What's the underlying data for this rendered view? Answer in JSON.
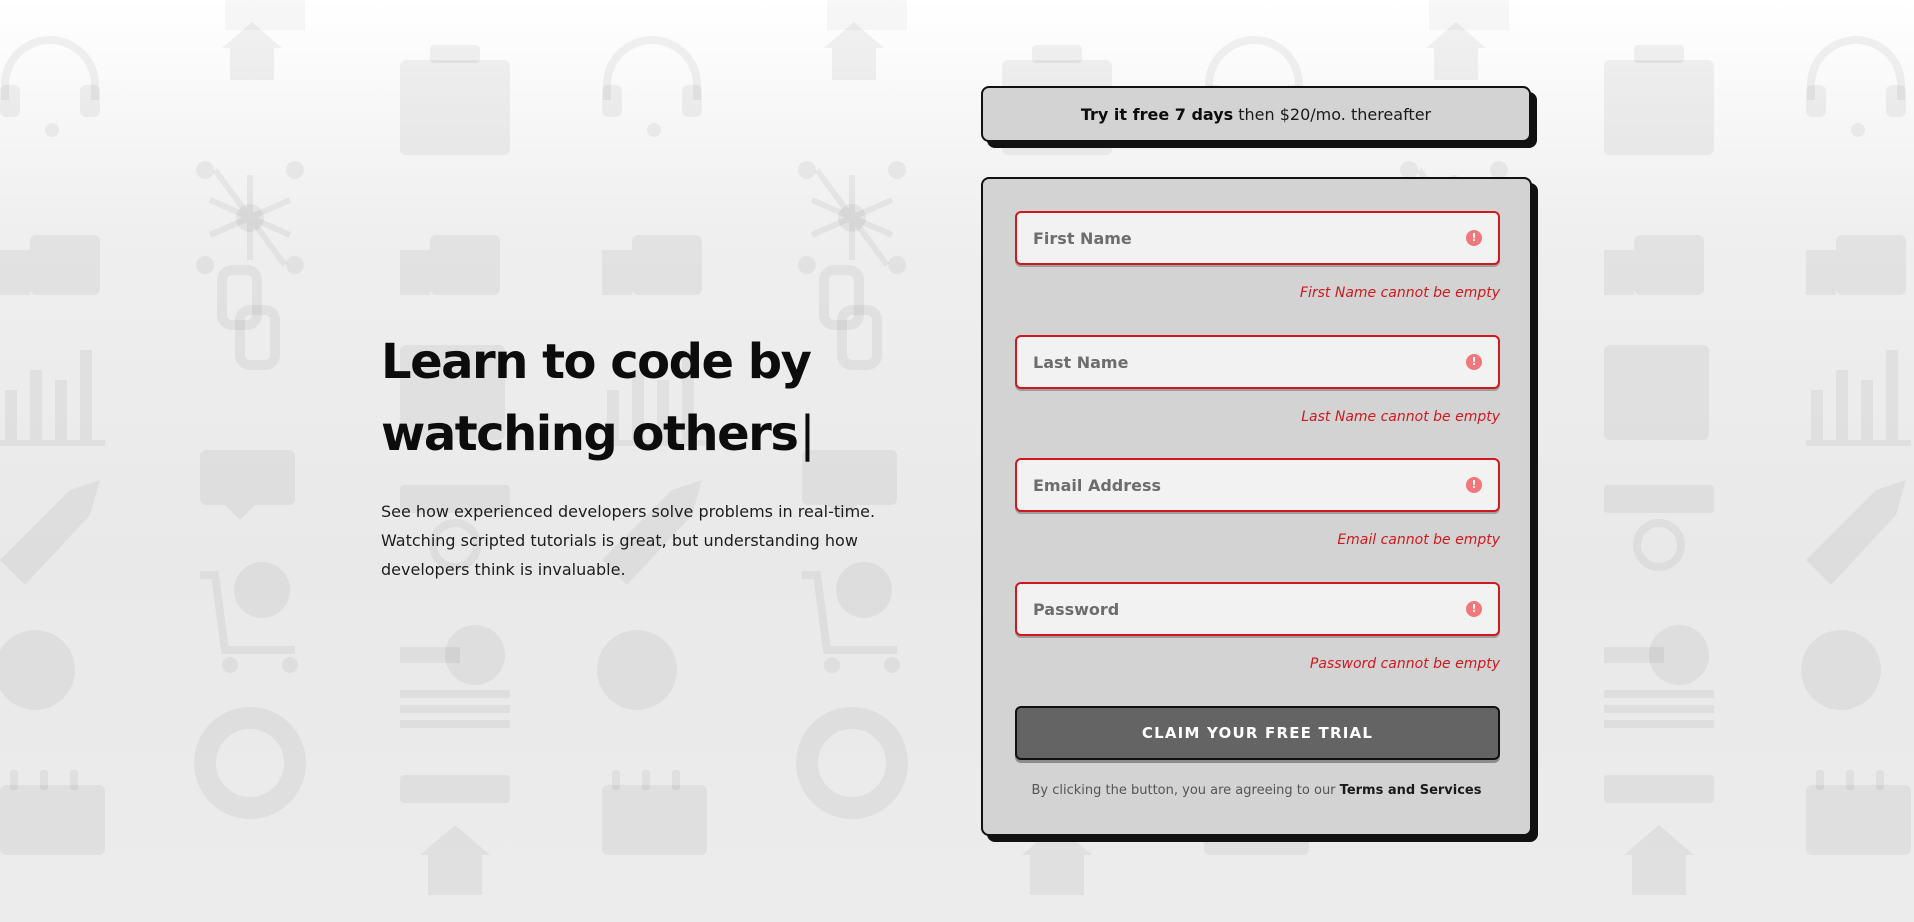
{
  "hero": {
    "title_line1": "Learn to code by",
    "title_line2": "watching others",
    "caret": "|",
    "description": "See how experienced developers solve problems in real-time. Watching scripted tutorials is great, but understanding how developers think is invaluable."
  },
  "trial_banner": {
    "bold": "Try it free 7 days",
    "rest": "then $20/mo. thereafter"
  },
  "form": {
    "fields": [
      {
        "placeholder": "First Name",
        "value": "",
        "error": "First Name cannot be empty"
      },
      {
        "placeholder": "Last Name",
        "value": "",
        "error": "Last Name cannot be empty"
      },
      {
        "placeholder": "Email Address",
        "value": "",
        "error": "Email cannot be empty"
      },
      {
        "placeholder": "Password",
        "value": "",
        "error": "Password cannot be empty"
      }
    ],
    "error_icon_glyph": "!",
    "submit_label": "CLAIM YOUR FREE TRIAL",
    "terms_prefix": "By clicking the button, you are agreeing to our",
    "terms_link": "Terms and Services"
  },
  "colors": {
    "error": "#d0191f",
    "error_icon": "#f2777a",
    "card_background": "#d3d3d3",
    "button_background": "#646464"
  },
  "background_icons": [
    "headset-icon",
    "house-icon",
    "briefcase-icon",
    "network-icon",
    "thumbs-up-icon",
    "chain-link-icon",
    "bar-chart-icon",
    "chat-bubble-icon",
    "rocket-icon",
    "cart-icon",
    "gear-icon",
    "key-icon",
    "globe-icon",
    "lifebuoy-icon",
    "calendar-icon",
    "browser-window-icon"
  ]
}
